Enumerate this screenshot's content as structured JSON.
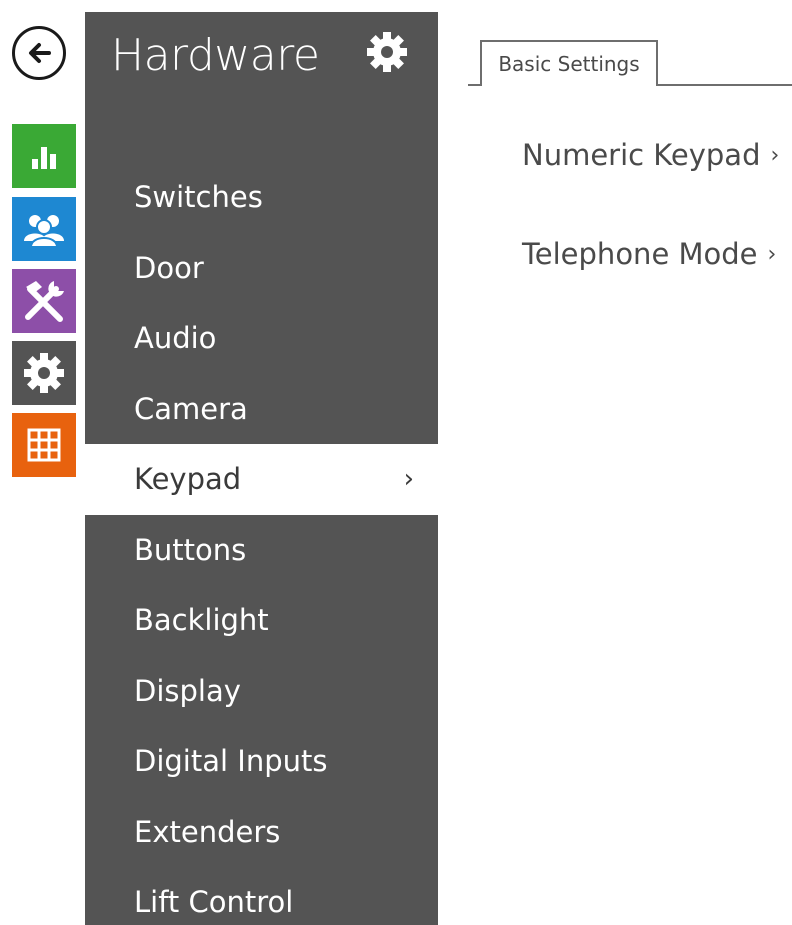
{
  "rail": {
    "back": {
      "icon": "back-arrow-icon"
    },
    "items": [
      {
        "name": "status",
        "icon": "bar-chart-icon",
        "color": "#3aa935"
      },
      {
        "name": "directory",
        "icon": "users-icon",
        "color": "#1e88d2"
      },
      {
        "name": "services",
        "icon": "tools-icon",
        "color": "#8d4fa8"
      },
      {
        "name": "hardware",
        "icon": "gear-icon",
        "color": "#545454"
      },
      {
        "name": "system",
        "icon": "grid-icon",
        "color": "#e8620e"
      }
    ]
  },
  "menu": {
    "title": "Hardware",
    "background": "#545454",
    "items": [
      {
        "label": "Switches"
      },
      {
        "label": "Door"
      },
      {
        "label": "Audio"
      },
      {
        "label": "Camera"
      },
      {
        "label": "Keypad",
        "active": true,
        "chevron": "›"
      },
      {
        "label": "Buttons"
      },
      {
        "label": "Backlight"
      },
      {
        "label": "Display"
      },
      {
        "label": "Digital Inputs"
      },
      {
        "label": "Extenders"
      },
      {
        "label": "Lift Control"
      }
    ]
  },
  "tabs": [
    {
      "label": "Basic Settings",
      "active": true
    }
  ],
  "content": {
    "links": [
      {
        "label": "Numeric Keypad",
        "arrow": "›"
      },
      {
        "label": "Telephone Mode",
        "arrow": "›"
      }
    ]
  }
}
